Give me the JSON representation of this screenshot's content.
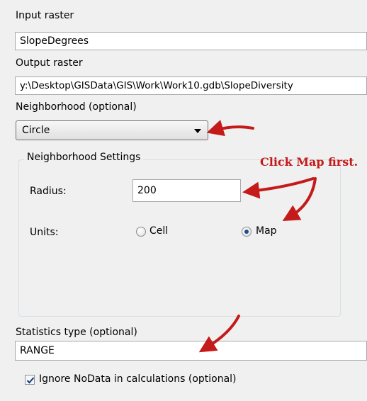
{
  "input_raster": {
    "label": "Input raster",
    "value": "SlopeDegrees"
  },
  "output_raster": {
    "label": "Output raster",
    "value": "y:\\Desktop\\GISData\\GIS\\Work\\Work10.gdb\\SlopeDiversity"
  },
  "neighborhood": {
    "label": "Neighborhood (optional)",
    "selected": "Circle"
  },
  "neighborhood_settings": {
    "title": "Neighborhood Settings",
    "radius_label": "Radius:",
    "radius_value": "200",
    "units_label": "Units:",
    "unit_options": [
      {
        "label": "Cell",
        "selected": false
      },
      {
        "label": "Map",
        "selected": true
      }
    ]
  },
  "statistics_type": {
    "label": "Statistics type (optional)",
    "value": "RANGE"
  },
  "ignore_nodata": {
    "label": "Ignore NoData in calculations (optional)",
    "checked": true
  },
  "annotation": {
    "text": "Click Map first.",
    "color": "#c41a1a"
  },
  "colors": {
    "background": "#f0f0f0",
    "arrow": "#c41a1a",
    "radio_dot": "#1c4e8c"
  },
  "icons": [
    "dropdown-arrow-icon",
    "red-arrow-icon",
    "checkmark-icon"
  ]
}
